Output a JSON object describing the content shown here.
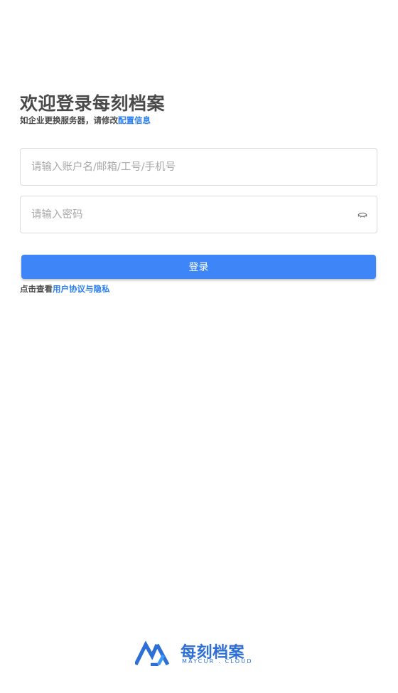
{
  "header": {
    "title": "欢迎登录每刻档案",
    "subtitle_prefix": "如企业更换服务器，请修改",
    "subtitle_link": "配置信息"
  },
  "form": {
    "account_placeholder": "请输入账户名/邮箱/工号/手机号",
    "account_value": "",
    "password_placeholder": "请输入密码",
    "password_value": "",
    "password_toggle_icon": "eye-closed-icon",
    "login_label": "登录"
  },
  "agreement": {
    "prefix": "点击查看",
    "link": "用户协议与隐私"
  },
  "brand": {
    "name": "每刻档案",
    "subtitle": "MAYCUR . CLOUD",
    "logo_icon": "maycur-logo-icon"
  },
  "colors": {
    "accent": "#3e86f8",
    "link": "#2a7ef0",
    "brand": "#2d6fd6",
    "text": "#4a4a4a",
    "placeholder": "#a8a8a8"
  }
}
